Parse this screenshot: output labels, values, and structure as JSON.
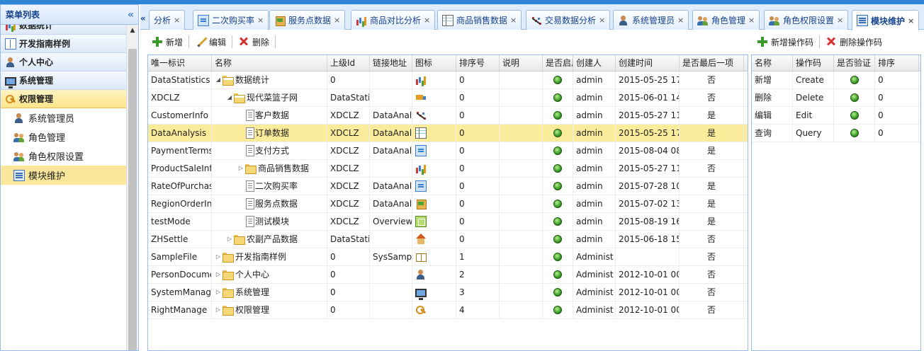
{
  "sidebar": {
    "title": "菜单列表",
    "collapse_icon": "«",
    "partial_label": "数据统计",
    "groups": [
      {
        "label": "开发指南样例",
        "icon": "book-icon"
      },
      {
        "label": "个人中心",
        "icon": "user-icon"
      },
      {
        "label": "系统管理",
        "icon": "monitor-icon"
      },
      {
        "label": "权限管理",
        "icon": "key-icon"
      }
    ],
    "items": [
      {
        "label": "系统管理员",
        "icon": "user-icon"
      },
      {
        "label": "角色管理",
        "icon": "users-icon"
      },
      {
        "label": "角色权限设置",
        "icon": "users-icon"
      },
      {
        "label": "模块维护",
        "icon": "module-icon"
      }
    ]
  },
  "tabs": {
    "scroll_left": "«",
    "items": [
      {
        "label": "分析"
      },
      {
        "label": "二次购买率"
      },
      {
        "label": "服务点数据"
      },
      {
        "label": "商品对比分析"
      },
      {
        "label": "商品销售数据"
      },
      {
        "label": "交易数据分析"
      },
      {
        "label": "系统管理员"
      },
      {
        "label": "角色管理"
      },
      {
        "label": "角色权限设置"
      },
      {
        "label": "模块维护"
      }
    ],
    "close": "×"
  },
  "left_toolbar": {
    "add": "新增",
    "edit": "编辑",
    "delete": "删除"
  },
  "right_toolbar": {
    "add_op": "新增操作码",
    "delete_op": "删除操作码"
  },
  "module_grid": {
    "columns": [
      "唯一标识",
      "名称",
      "上级Id",
      "链接地址",
      "图标",
      "排序号",
      "说明",
      "是否启用",
      "创建人",
      "创建时间",
      "是否最后一项"
    ],
    "rows": [
      {
        "id": "DataStatistics",
        "name": "数据统计",
        "parent": "0",
        "link": "",
        "icon": "chart-icon",
        "order": "0",
        "desc": "",
        "creator": "admin",
        "created": "2015-05-25 17",
        "last": "否"
      },
      {
        "id": "XDCLZ",
        "name": "现代菜篮子网",
        "parent": "DataStatis",
        "link": "",
        "icon": "truck-icon",
        "order": "0",
        "desc": "",
        "creator": "admin",
        "created": "2015-06-01 14",
        "last": "否"
      },
      {
        "id": "CustomerInfo",
        "name": "客户数据",
        "parent": "XDCLZ",
        "link": "DataAnaly",
        "icon": "scatter-icon",
        "order": "0",
        "desc": "",
        "creator": "admin",
        "created": "2015-05-27 11",
        "last": "是"
      },
      {
        "id": "DataAnalysis",
        "name": "订单数据",
        "parent": "XDCLZ",
        "link": "DataAnaly",
        "icon": "table-icon",
        "order": "0",
        "desc": "",
        "creator": "admin",
        "created": "2015-05-25 17",
        "last": "是"
      },
      {
        "id": "PaymentTerms",
        "name": "支付方式",
        "parent": "XDCLZ",
        "link": "DataAnaly",
        "icon": "card-icon",
        "order": "0",
        "desc": "",
        "creator": "admin",
        "created": "2015-08-04 08",
        "last": "是"
      },
      {
        "id": "ProductSaleInf",
        "name": "商品销售数据",
        "parent": "XDCLZ",
        "link": "",
        "icon": "chart-icon",
        "order": "0",
        "desc": "",
        "creator": "admin",
        "created": "2015-05-27 11",
        "last": "否"
      },
      {
        "id": "RateOfPurchas",
        "name": "二次购买率",
        "parent": "XDCLZ",
        "link": "DataAnaly",
        "icon": "card-icon",
        "order": "0",
        "desc": "",
        "creator": "admin",
        "created": "2015-07-28 10",
        "last": "是"
      },
      {
        "id": "RegionOrderIn",
        "name": "服务点数据",
        "parent": "XDCLZ",
        "link": "DataAnaly",
        "icon": "box-icon",
        "order": "0",
        "desc": "",
        "creator": "admin",
        "created": "2015-07-02 13",
        "last": "是"
      },
      {
        "id": "testMode",
        "name": "测试模块",
        "parent": "XDCLZ",
        "link": "Overview,",
        "icon": "screen-icon",
        "order": "0",
        "desc": "",
        "creator": "admin",
        "created": "2015-08-19 16",
        "last": "是"
      },
      {
        "id": "ZHSettle",
        "name": "农副产品数据",
        "parent": "DataStatis",
        "link": "",
        "icon": "house-icon",
        "order": "0",
        "desc": "",
        "creator": "admin",
        "created": "2015-06-18 15",
        "last": "否"
      },
      {
        "id": "SampleFile",
        "name": "开发指南样例",
        "parent": "0",
        "link": "SysSampl",
        "icon": "openbook-icon",
        "order": "1",
        "desc": "",
        "creator": "Administ",
        "created": "",
        "last": "否"
      },
      {
        "id": "PersonDocume",
        "name": "个人中心",
        "parent": "0",
        "link": "",
        "icon": "user-icon",
        "order": "2",
        "desc": "",
        "creator": "Administ",
        "created": "2012-10-01 00",
        "last": "否"
      },
      {
        "id": "SystemManage",
        "name": "系统管理",
        "parent": "0",
        "link": "",
        "icon": "monitor-icon",
        "order": "3",
        "desc": "",
        "creator": "Administ",
        "created": "2012-10-01 00",
        "last": "否"
      },
      {
        "id": "RightManage",
        "name": "权限管理",
        "parent": "0",
        "link": "",
        "icon": "key-icon",
        "order": "4",
        "desc": "",
        "creator": "Administ",
        "created": "2012-10-01 00",
        "last": "否"
      }
    ]
  },
  "op_grid": {
    "columns": [
      "名称",
      "操作码",
      "是否验证",
      "排序"
    ],
    "rows": [
      {
        "name": "新增",
        "code": "Create",
        "order": "0"
      },
      {
        "name": "删除",
        "code": "Delete",
        "order": "0"
      },
      {
        "name": "编辑",
        "code": "Edit",
        "order": "0"
      },
      {
        "name": "查询",
        "code": "Query",
        "order": "0"
      }
    ]
  },
  "colors": {
    "accent": "#2f86d6",
    "selected_row": "#fbec9c",
    "active_menu": "#fbe79b",
    "border": "#99bbe8"
  }
}
